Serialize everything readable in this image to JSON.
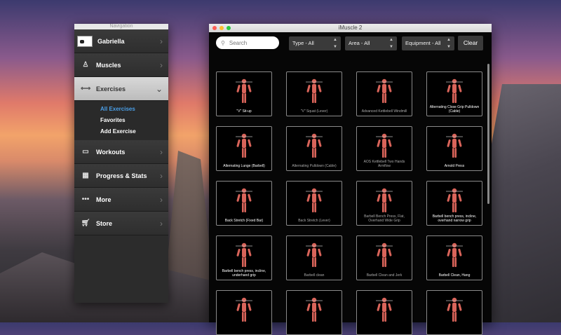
{
  "navigation": {
    "window_title": "Navigation",
    "user_name": "Gabriella",
    "items": [
      {
        "label": "Muscles",
        "icon": "muscles-icon"
      },
      {
        "label": "Exercises",
        "icon": "exercises-icon",
        "selected": true
      },
      {
        "label": "Workouts",
        "icon": "workouts-icon"
      },
      {
        "label": "Progress & Stats",
        "icon": "calendar-icon"
      },
      {
        "label": "More",
        "icon": "more-dots-icon"
      },
      {
        "label": "Store",
        "icon": "cart-icon"
      }
    ],
    "sub_items": [
      "All Exercises",
      "Favorites",
      "Add Exercise"
    ]
  },
  "app": {
    "title": "iMuscle 2",
    "search_placeholder": "Search",
    "filters": {
      "type": "Type - All",
      "area": "Area - All",
      "equipment": "Equipment - All"
    },
    "clear_label": "Clear"
  },
  "exercises": [
    "\"V\" Sit-up",
    "\"V\" Squat (Lever)",
    "Advanced Kettlebell Windmill",
    "Alternating Close Grip Pulldown (Cable)",
    "Alternating Lunge (Barbell)",
    "Alternating Pulldown (Cable)",
    "AOS Kettlebell Two Hands Armflow",
    "Arnold Press",
    "Back Stretch (Fixed Bar)",
    "Back Stretch (Lever)",
    "Barbell Bench Press, Flat, Overhand Wide Grip",
    "Barbell bench press, incline, overhand narrow grip",
    "Barbell bench press, incline, underhand grip",
    "Barbell clean",
    "Barbell Clean and Jerk",
    "Barbell Clean, Hang",
    "",
    "",
    "",
    ""
  ],
  "colors": {
    "accent": "#4a9ee6",
    "figure": "#d9645a"
  }
}
